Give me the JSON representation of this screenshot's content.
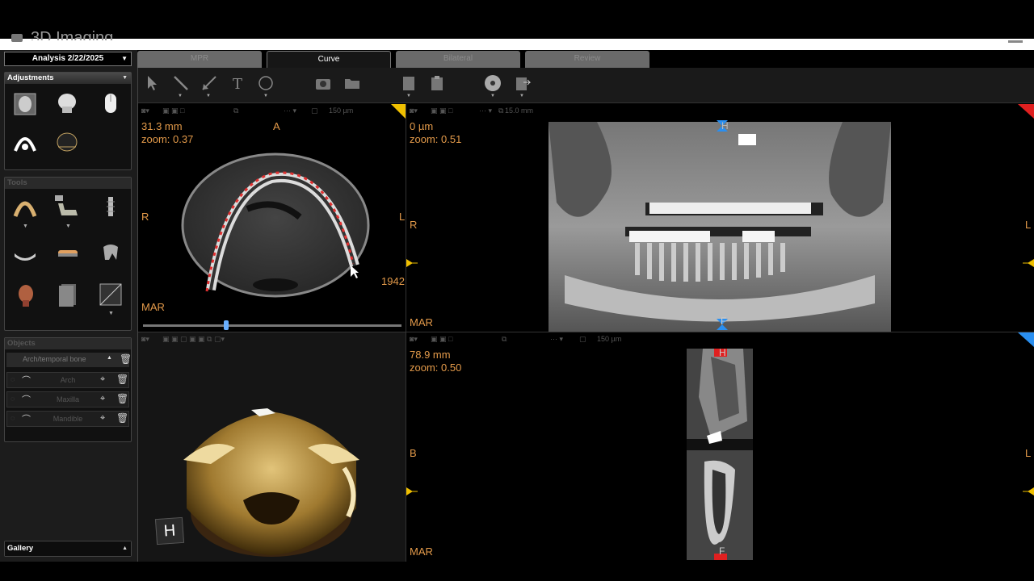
{
  "window": {
    "title": "3D Imaging"
  },
  "analysis": {
    "label": "Analysis 2/22/2025"
  },
  "tabs": [
    {
      "label": "MPR",
      "active": false
    },
    {
      "label": "Curve",
      "active": true
    },
    {
      "label": "Bilateral",
      "active": false
    },
    {
      "label": "Review",
      "active": false
    }
  ],
  "panels": {
    "adjustments": {
      "title": "Adjustments"
    },
    "tools": {
      "title": "Tools"
    },
    "objects": {
      "title": "Objects",
      "group": "Arch/temporal bone",
      "items": [
        {
          "label": "Arch"
        },
        {
          "label": "Maxilla"
        },
        {
          "label": "Mandible"
        }
      ]
    },
    "gallery": {
      "title": "Gallery"
    }
  },
  "viewports": {
    "axial": {
      "distance": "31.3 mm",
      "zoom": "zoom: 0.37",
      "orient_top": "A",
      "orient_left": "R",
      "orient_right": "L",
      "mar": "MAR",
      "slice_num": "1942",
      "scale": "150 µm"
    },
    "panoramic": {
      "distance": "0 µm",
      "zoom": "zoom: 0.51",
      "orient_top": "H",
      "orient_left": "R",
      "orient_right": "L",
      "orient_bottom": "F",
      "mar": "MAR",
      "scale": "15.0 mm"
    },
    "volume3d": {
      "cube_label": "H"
    },
    "cross": {
      "distance": "78.9 mm",
      "zoom": "zoom: 0.50",
      "orient_top": "H",
      "orient_left": "B",
      "orient_right": "L",
      "orient_bottom": "F",
      "mar": "MAR",
      "scale": "150 µm"
    }
  },
  "colors": {
    "accent_orange": "#e39a4a",
    "yellow": "#f0c000",
    "red": "#e02020",
    "blue": "#2a8ff0"
  }
}
